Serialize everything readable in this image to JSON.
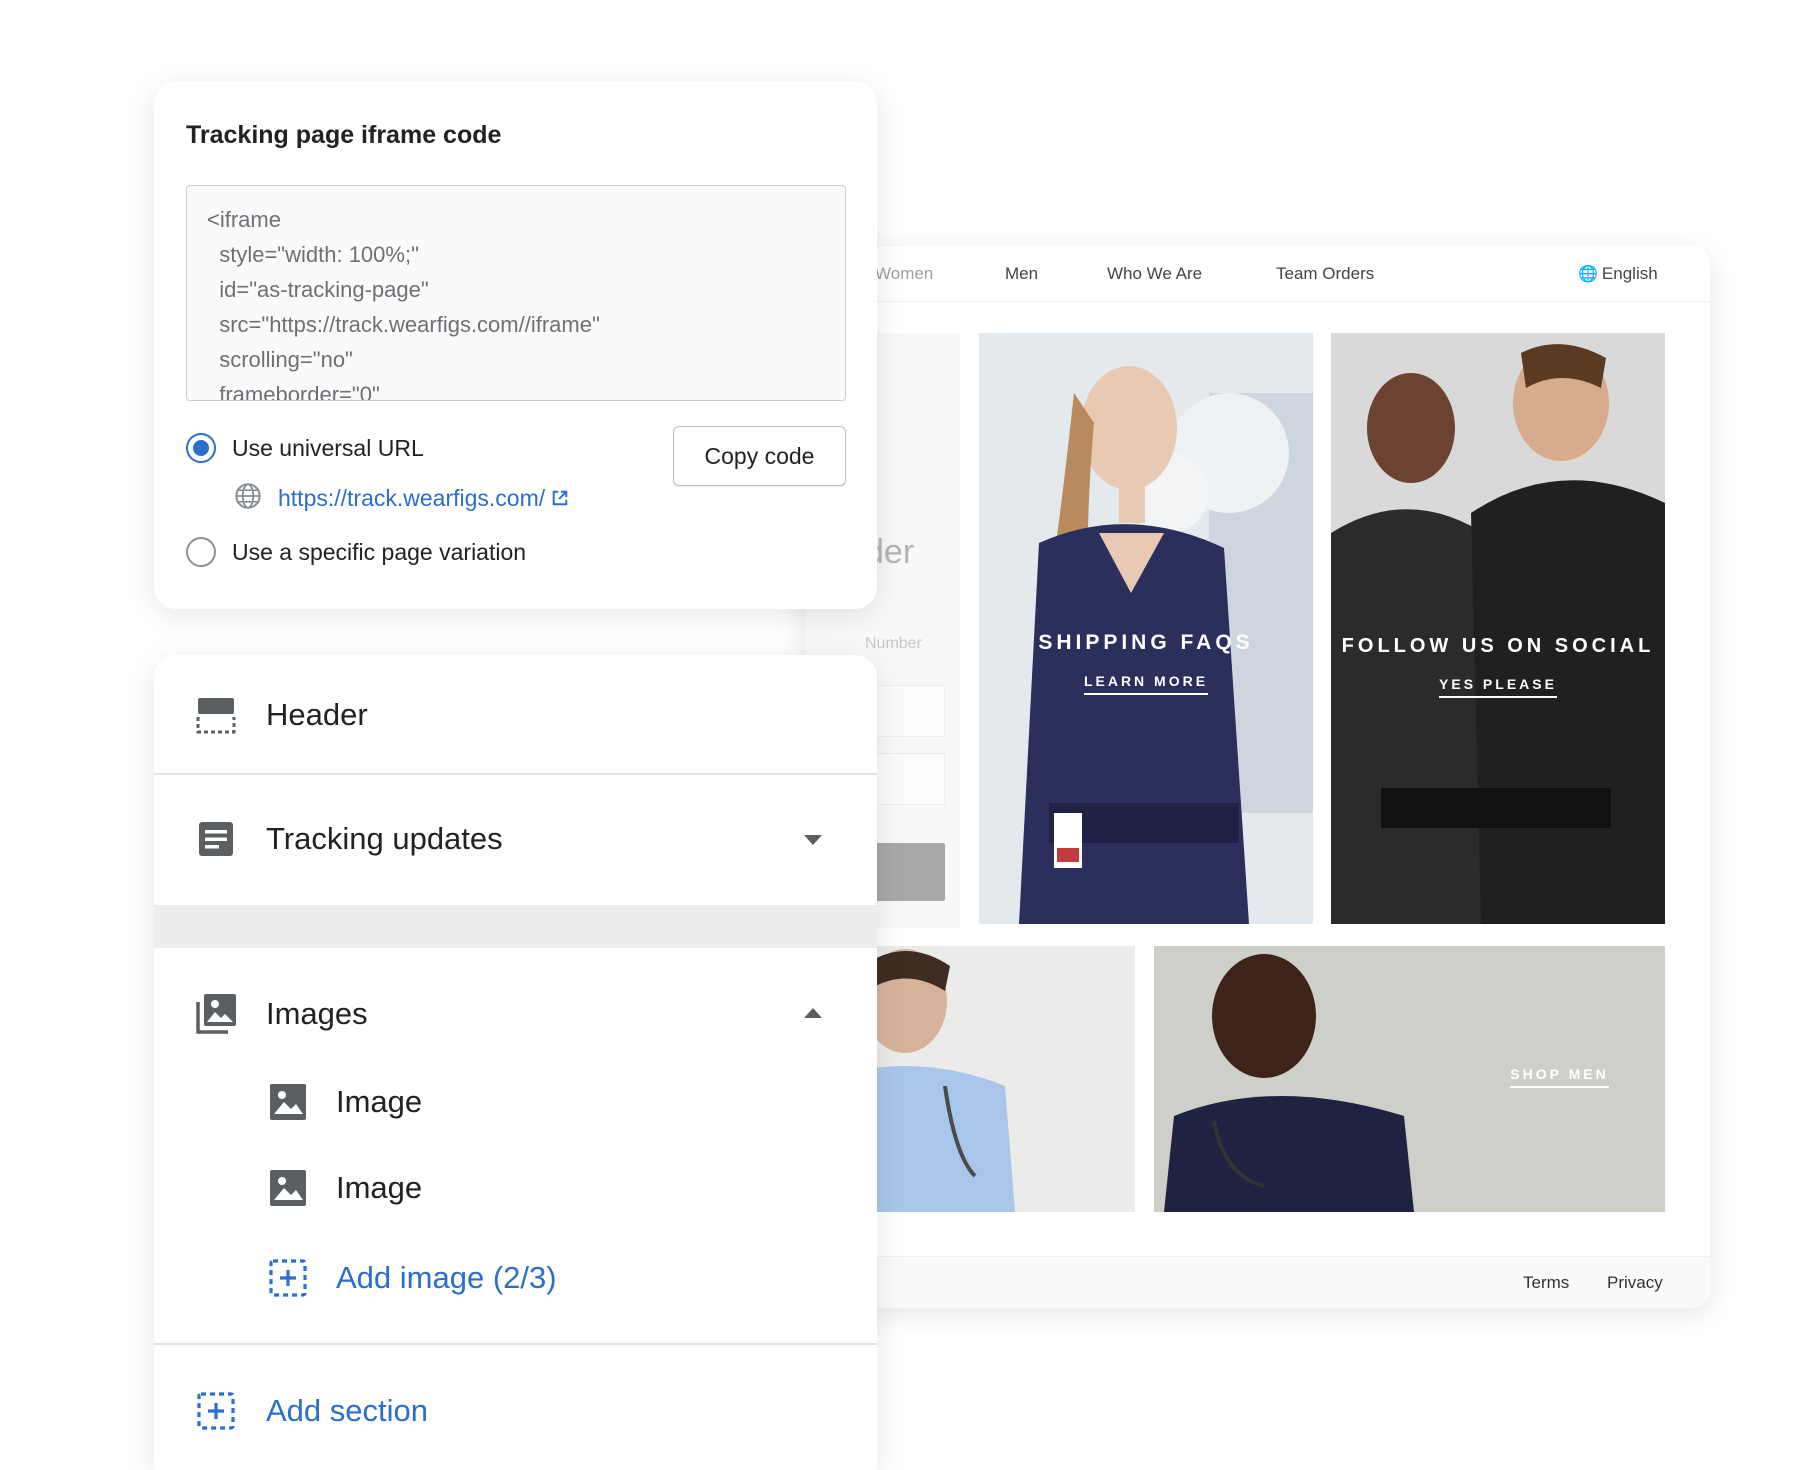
{
  "embed_card": {
    "title": "Tracking page iframe code",
    "code": "<iframe\n  style=\"width: 100%;\"\n  id=\"as-tracking-page\"\n  src=\"https://track.wearfigs.com//iframe\"\n  scrolling=\"no\"\n  frameborder=\"0\"",
    "option_universal": "Use universal URL",
    "universal_url": "https://track.wearfigs.com/",
    "option_variation": "Use a specific page variation",
    "selected_option": "universal",
    "copy_button": "Copy code"
  },
  "sections_panel": {
    "header_label": "Header",
    "tracking_label": "Tracking updates",
    "images_label": "Images",
    "image_items": [
      "Image",
      "Image"
    ],
    "add_image_label": "Add image (2/3)",
    "add_section_label": "Add section"
  },
  "preview": {
    "nav": {
      "women": "Women",
      "men": "Men",
      "who": "Who We Are",
      "team": "Team Orders",
      "language": "English"
    },
    "ghost_title": "der",
    "ghost_label": "Number",
    "tiles": {
      "shipping": "SHIPPING FAQS",
      "shipping_cta": "LEARN MORE",
      "social": "FOLLOW US ON SOCIAL",
      "social_cta": "YES PLEASE",
      "shop_men": "SHOP MEN"
    },
    "footer": {
      "terms": "Terms",
      "privacy": "Privacy"
    }
  },
  "colors": {
    "accent": "#2c6ecb",
    "text": "#202223",
    "navy_scrubs": "#2b2f5c"
  }
}
